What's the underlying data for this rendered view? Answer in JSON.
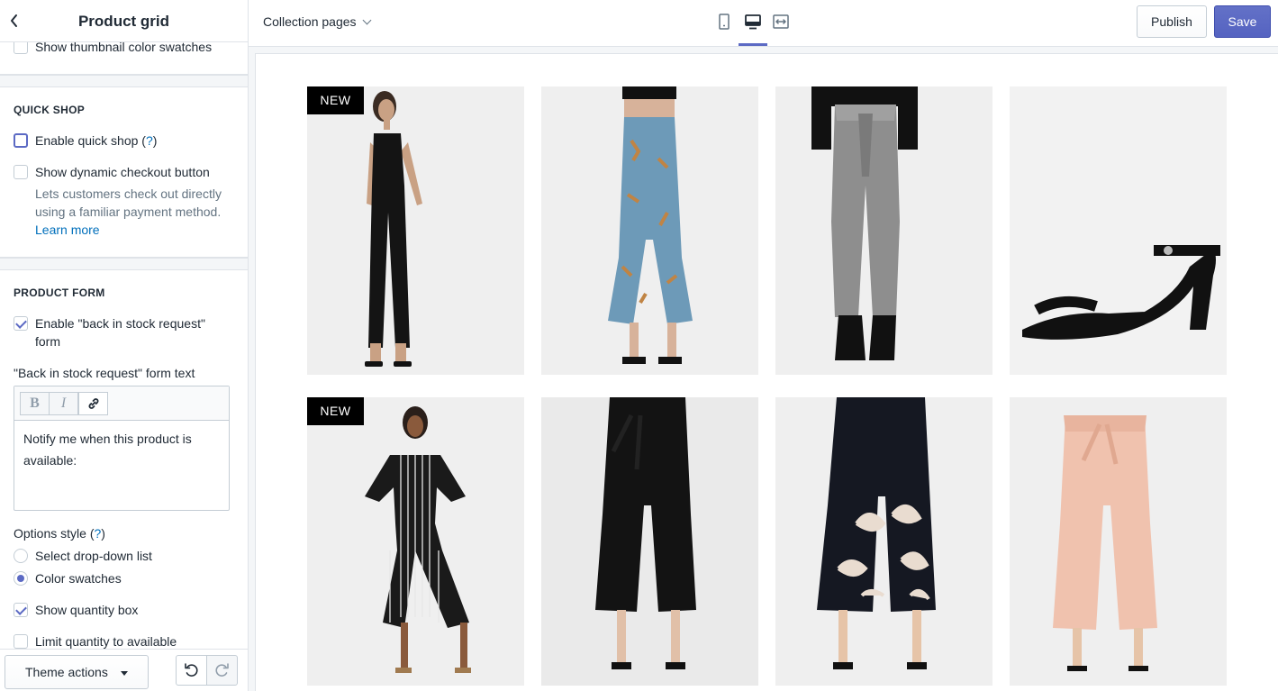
{
  "sidebar": {
    "title": "Product grid",
    "truncated_item": "Show thumbnail color swatches",
    "quick_shop": {
      "heading": "QUICK SHOP",
      "enable_label": "Enable quick shop (",
      "enable_help_link": "?",
      "enable_close": ")",
      "dynamic_checkout_label": "Show dynamic checkout button",
      "dynamic_checkout_help": "Lets customers check out directly using a familiar payment method.",
      "learn_more": "Learn more"
    },
    "product_form": {
      "heading": "PRODUCT FORM",
      "back_in_stock_label_line1": "Enable \"back in stock request\"",
      "back_in_stock_label_line2": "form",
      "form_text_label": "\"Back in stock request\" form text",
      "rte_bold": "B",
      "rte_italic": "I",
      "form_text_value": "Notify me when this product is available:",
      "options_style_label": "Options style (",
      "options_style_help": "?",
      "options_style_close": ")",
      "option_dropdown": "Select drop-down list",
      "option_swatches": "Color swatches",
      "show_quantity_label": "Show quantity box",
      "limit_quantity_label": "Limit quantity to available"
    },
    "footer": {
      "theme_actions": "Theme actions"
    }
  },
  "topbar": {
    "page_select": "Collection pages",
    "publish": "Publish",
    "save": "Save"
  },
  "preview": {
    "products": [
      {
        "badge": "NEW",
        "image": "black jumpsuit"
      },
      {
        "badge": "",
        "image": "blue floral flare pants"
      },
      {
        "badge": "",
        "image": "grey paperbag pants"
      },
      {
        "badge": "",
        "image": "black block heel sandal"
      },
      {
        "badge": "NEW",
        "image": "striped jumpsuit"
      },
      {
        "badge": "",
        "image": "black wide leg pants"
      },
      {
        "badge": "",
        "image": "crane print culottes"
      },
      {
        "badge": "",
        "image": "pink wide leg pants"
      }
    ]
  },
  "colors": {
    "accent": "#5c6ac4",
    "link": "#006fbb",
    "border": "#dfe3e8"
  }
}
